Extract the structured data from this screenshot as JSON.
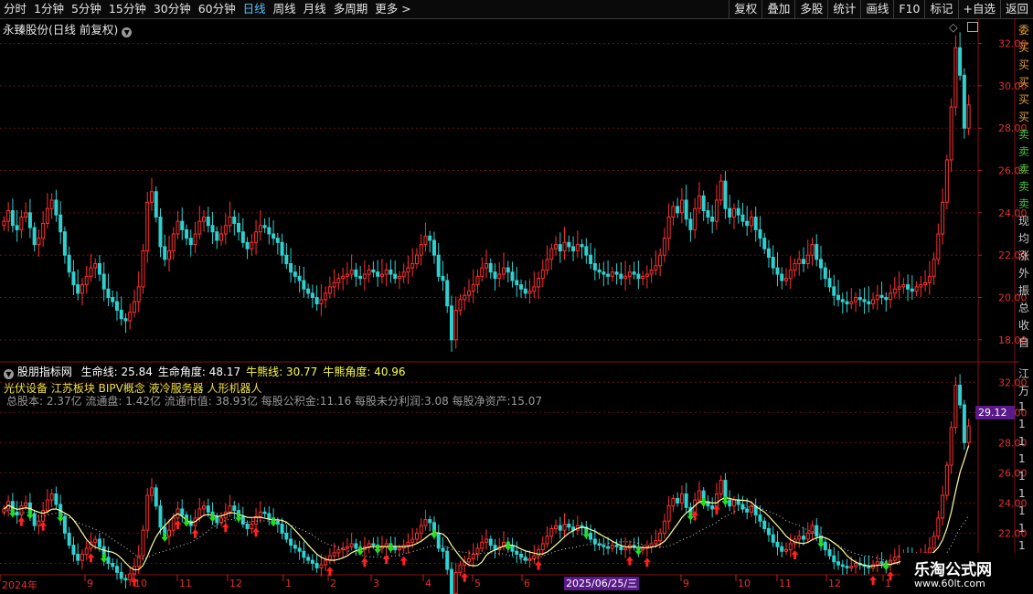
{
  "toolbar": {
    "periods": [
      "分时",
      "1分钟",
      "5分钟",
      "15分钟",
      "30分钟",
      "60分钟",
      "日线",
      "周线",
      "月线",
      "多周期",
      "更多 >"
    ],
    "active_period": "日线",
    "buttons": [
      "复权",
      "叠加",
      "多股",
      "统计",
      "画线",
      "F10",
      "标记",
      "+自选",
      "返回"
    ]
  },
  "main_panel": {
    "title": "永臻股份(日线 前复权)",
    "y_ticks": [
      "32.00",
      "30.00",
      "28.00",
      "26.00",
      "24.00",
      "22.00",
      "20.00",
      "18.00"
    ]
  },
  "indicator_panel": {
    "name": "股朋指标网",
    "values": [
      {
        "label": "生命线:",
        "value": "25.84",
        "color": "#ffffff"
      },
      {
        "label": "生命角度:",
        "value": "48.17",
        "color": "#ffffff"
      },
      {
        "label": "牛熊线:",
        "value": "30.77",
        "color": "#ffff40"
      },
      {
        "label": "牛熊角度:",
        "value": "40.96",
        "color": "#ffff40"
      }
    ],
    "concepts": "光伏设备 江苏板块 BIPV概念 液冷服务器 人形机器人",
    "fundamentals": "总股本: 2.37亿 流通盘: 1.42亿 流通市值: 38.93亿 每股公积金:11.16 每股未分利润:3.08 每股净资产:15.07",
    "y_ticks": [
      "32.00",
      "30.00",
      "28.00",
      "26.00",
      "24.00",
      "22.00",
      "20.00"
    ],
    "current_price": "29.12"
  },
  "x_axis": {
    "labels": [
      "2024年",
      "9",
      "10",
      "11",
      "12",
      "1",
      "2",
      "3",
      "4",
      "5",
      "6",
      "2025/06/25/三",
      "9",
      "10",
      "11",
      "12",
      "1"
    ]
  },
  "right_panel": {
    "chars": [
      "委",
      "买",
      "买",
      "买",
      "买",
      "买",
      "卖",
      "卖",
      "卖",
      "卖",
      "卖",
      "现",
      "均",
      "涨",
      "外",
      "振",
      "总",
      "收",
      "自",
      "江",
      "万",
      "1",
      "1",
      "1",
      "1",
      "1",
      "1",
      "1",
      "1",
      "1"
    ]
  },
  "watermark": {
    "title": "乐淘公式网",
    "url": "www.60lt.com"
  },
  "colors": {
    "up": "#ff3030",
    "down": "#30d0d0",
    "grid": "#6a1010",
    "life_line": "#ffffa0",
    "bear_line": "#d8d8d8"
  },
  "chart_data": {
    "type": "candlestick",
    "ylim": [
      17,
      32.5
    ],
    "closes": [
      23.6,
      24.1,
      23.4,
      23.2,
      23.8,
      24.0,
      23.3,
      22.5,
      22.8,
      23.5,
      24.2,
      24.6,
      23.9,
      23.1,
      22.0,
      21.2,
      20.6,
      20.2,
      20.6,
      21.0,
      21.4,
      21.6,
      21.1,
      20.4,
      20.0,
      19.8,
      19.4,
      19.0,
      18.9,
      19.3,
      19.8,
      20.5,
      22.2,
      24.5,
      25.0,
      23.8,
      22.4,
      21.8,
      22.2,
      23.0,
      23.6,
      23.2,
      22.8,
      22.5,
      23.0,
      23.6,
      23.8,
      23.4,
      23.1,
      22.7,
      23.0,
      23.4,
      23.8,
      23.5,
      23.1,
      22.6,
      22.3,
      22.6,
      23.1,
      23.4,
      23.3,
      23.0,
      22.8,
      22.6,
      22.0,
      21.6,
      21.2,
      21.0,
      20.8,
      20.4,
      20.2,
      20.0,
      19.7,
      19.9,
      20.2,
      20.5,
      20.7,
      20.9,
      21.0,
      21.1,
      21.3,
      21.0,
      20.9,
      21.1,
      21.3,
      21.2,
      21.0,
      21.1,
      21.3,
      21.1,
      20.9,
      21.0,
      21.2,
      21.4,
      21.6,
      22.0,
      22.5,
      22.9,
      22.7,
      22.0,
      21.0,
      20.8,
      19.6,
      18.0,
      19.4,
      19.9,
      20.1,
      20.3,
      20.6,
      21.0,
      21.4,
      21.6,
      21.2,
      20.9,
      21.1,
      21.4,
      21.2,
      20.8,
      20.6,
      20.4,
      20.2,
      20.3,
      20.5,
      20.9,
      21.3,
      21.8,
      22.3,
      22.5,
      22.2,
      22.6,
      22.4,
      22.2,
      22.5,
      22.4,
      22.0,
      21.6,
      21.3,
      21.2,
      21.1,
      21.0,
      21.2,
      21.1,
      20.9,
      21.0,
      21.2,
      21.1,
      20.9,
      21.0,
      21.1,
      21.3,
      21.5,
      22.0,
      22.8,
      23.8,
      24.3,
      24.0,
      24.6,
      23.7,
      23.2,
      24.2,
      24.8,
      24.1,
      23.8,
      23.6,
      24.6,
      25.5,
      24.2,
      23.8,
      24.2,
      23.9,
      23.6,
      23.4,
      23.8,
      23.2,
      22.8,
      22.3,
      21.9,
      21.4,
      21.1,
      20.8,
      20.9,
      21.3,
      21.6,
      21.8,
      21.6,
      22.0,
      22.5,
      21.8,
      21.4,
      20.9,
      20.5,
      20.1,
      19.9,
      19.8,
      19.7,
      19.8,
      20.0,
      19.9,
      19.8,
      19.7,
      19.9,
      20.1,
      20.0,
      19.9,
      20.2,
      20.4,
      20.5,
      20.6,
      20.4,
      20.3,
      20.5,
      20.6,
      20.7,
      21.0,
      21.8,
      23.0,
      24.5,
      26.5,
      29.0,
      31.8,
      30.5,
      28.0,
      29.1
    ]
  }
}
